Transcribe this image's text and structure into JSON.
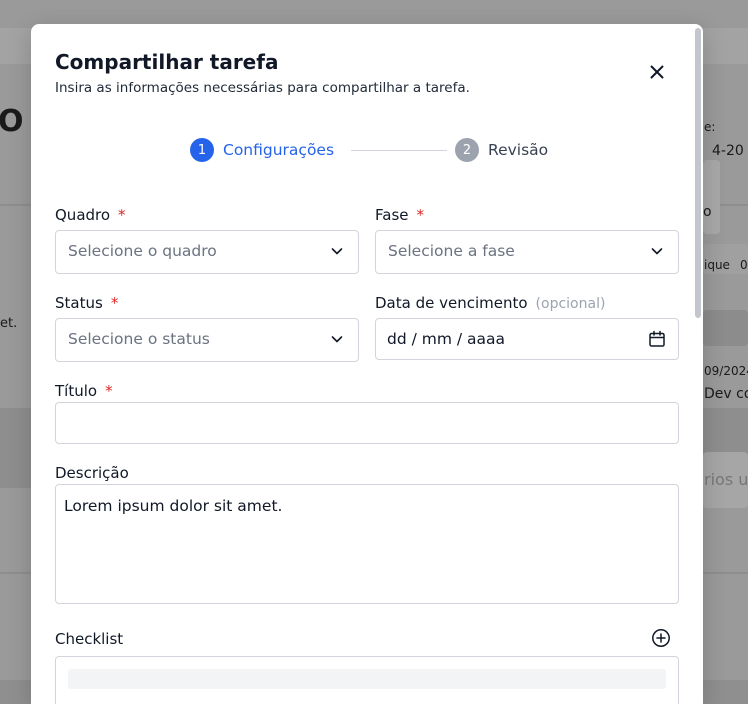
{
  "background": {
    "title_fragment": "O",
    "label_fragment": "e:",
    "date_fragment": "4-20",
    "button_fragment": "o",
    "table_fragment1": "ique",
    "table_fragment2": "0'",
    "sentence_fragment": "et.",
    "date_fragment2": "09/2024",
    "dev_fragment": "Dev co",
    "users_fragment": "rios us"
  },
  "modal": {
    "title": "Compartilhar tarefa",
    "subtitle": "Insira as informações necessárias para compartilhar a tarefa.",
    "close_icon": "close-icon"
  },
  "stepper": {
    "steps": [
      {
        "number": "1",
        "label": "Configurações",
        "active": true
      },
      {
        "number": "2",
        "label": "Revisão",
        "active": false
      }
    ],
    "active_color": "#2563eb",
    "inactive_color": "#9ca3af"
  },
  "form": {
    "board": {
      "label": "Quadro",
      "required": "*",
      "placeholder": "Selecione o quadro"
    },
    "phase": {
      "label": "Fase",
      "required": "*",
      "placeholder": "Selecione a fase"
    },
    "status": {
      "label": "Status",
      "required": "*",
      "placeholder": "Selecione o status"
    },
    "due_date": {
      "label": "Data de vencimento",
      "optional": "(opcional)",
      "placeholder": "dd / mm / aaaa"
    },
    "title": {
      "label": "Título",
      "required": "*",
      "value": ""
    },
    "description": {
      "label": "Descrição",
      "value": "Lorem ipsum dolor sit amet."
    },
    "checklist": {
      "label": "Checklist",
      "add_icon": "plus-circle-icon"
    }
  }
}
